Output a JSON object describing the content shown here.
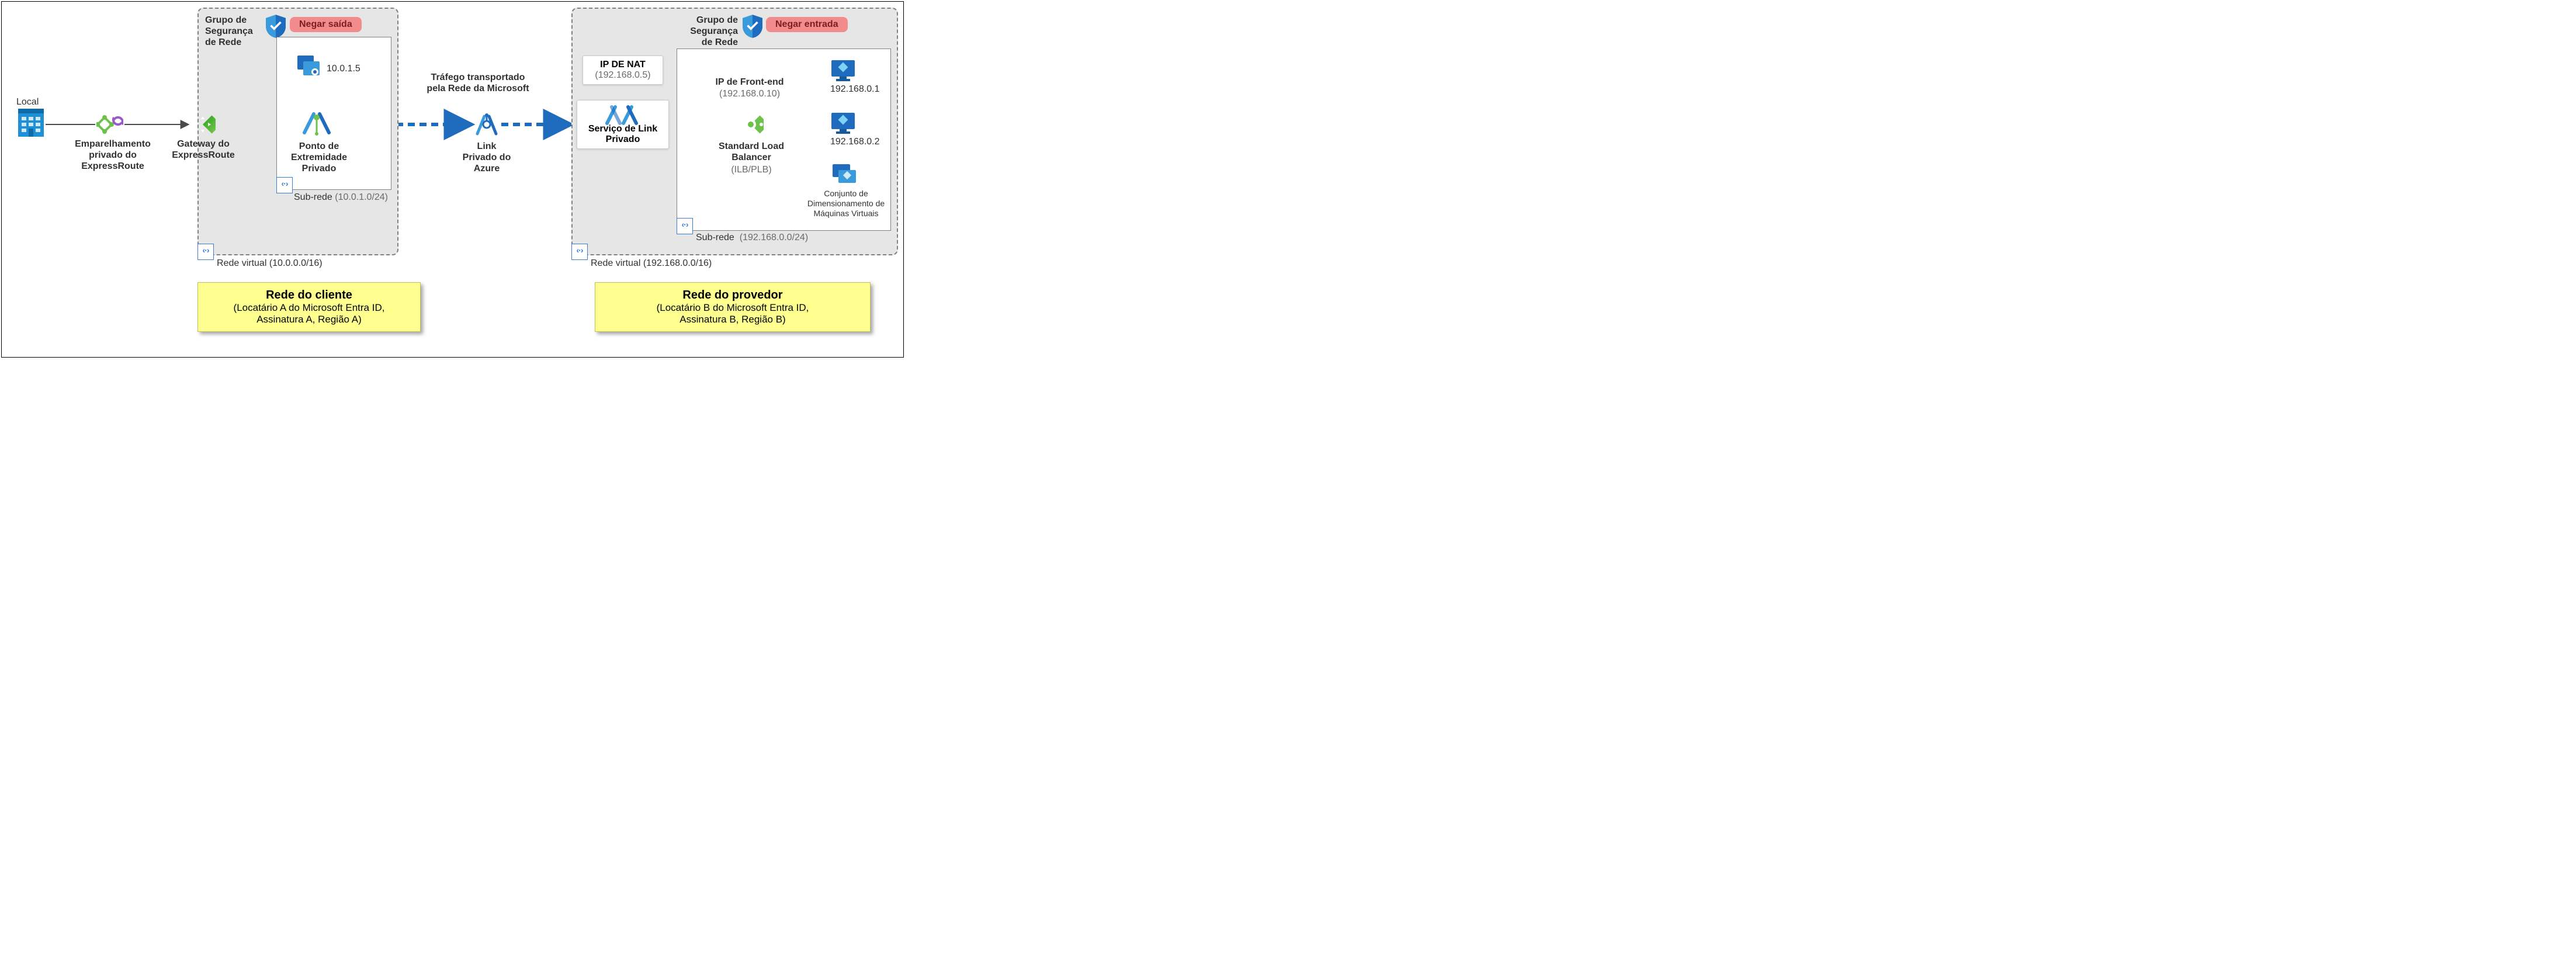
{
  "labels": {
    "local": "Local",
    "er_peering": "Emparelhamento\nprivado do\nExpressRoute",
    "er_gateway": "Gateway do\nExpressRoute",
    "pe": "Ponto de\nExtremidade\nPrivado",
    "nic_ip": "10.0.1.5",
    "subnet_left_label": "Sub-rede",
    "subnet_left_cidr": "(10.0.1.0/24)",
    "nsg_title": "Grupo de\nSegurança\nde Rede",
    "deny_out": "Negar saída",
    "vnet_left": "Rede virtual  (10.0.0.0/16)",
    "traffic": "Tráfego transportado\npela Rede da Microsoft",
    "apl": "Link\nPrivado do\nAzure",
    "nat_title": "IP DE NAT",
    "nat_ip": "(192.168.0.5)",
    "pls": "Serviço de Link\nPrivado",
    "deny_in": "Negar entrada",
    "fe_title": "IP de Front-end",
    "fe_ip": "(192.168.0.10)",
    "slb": "Standard Load\nBalancer",
    "slb_sub": "(ILB/PLB)",
    "vm1": "192.168.0.1",
    "vm2": "192.168.0.2",
    "vmss": "Conjunto de\nDimensionamento de\nMáquinas Virtuais",
    "subnet_right_label": "Sub-rede",
    "subnet_right_cidr": "(192.168.0.0/24)",
    "vnet_right": "Rede virtual  (192.168.0.0/16)",
    "client_net": "Rede do cliente",
    "client_sub": "(Locatário A do Microsoft Entra ID,\nAssinatura A, Região A)",
    "provider_net": "Rede do provedor",
    "provider_sub": "(Locatário B do Microsoft Entra ID,\nAssinatura B, Região B)"
  }
}
